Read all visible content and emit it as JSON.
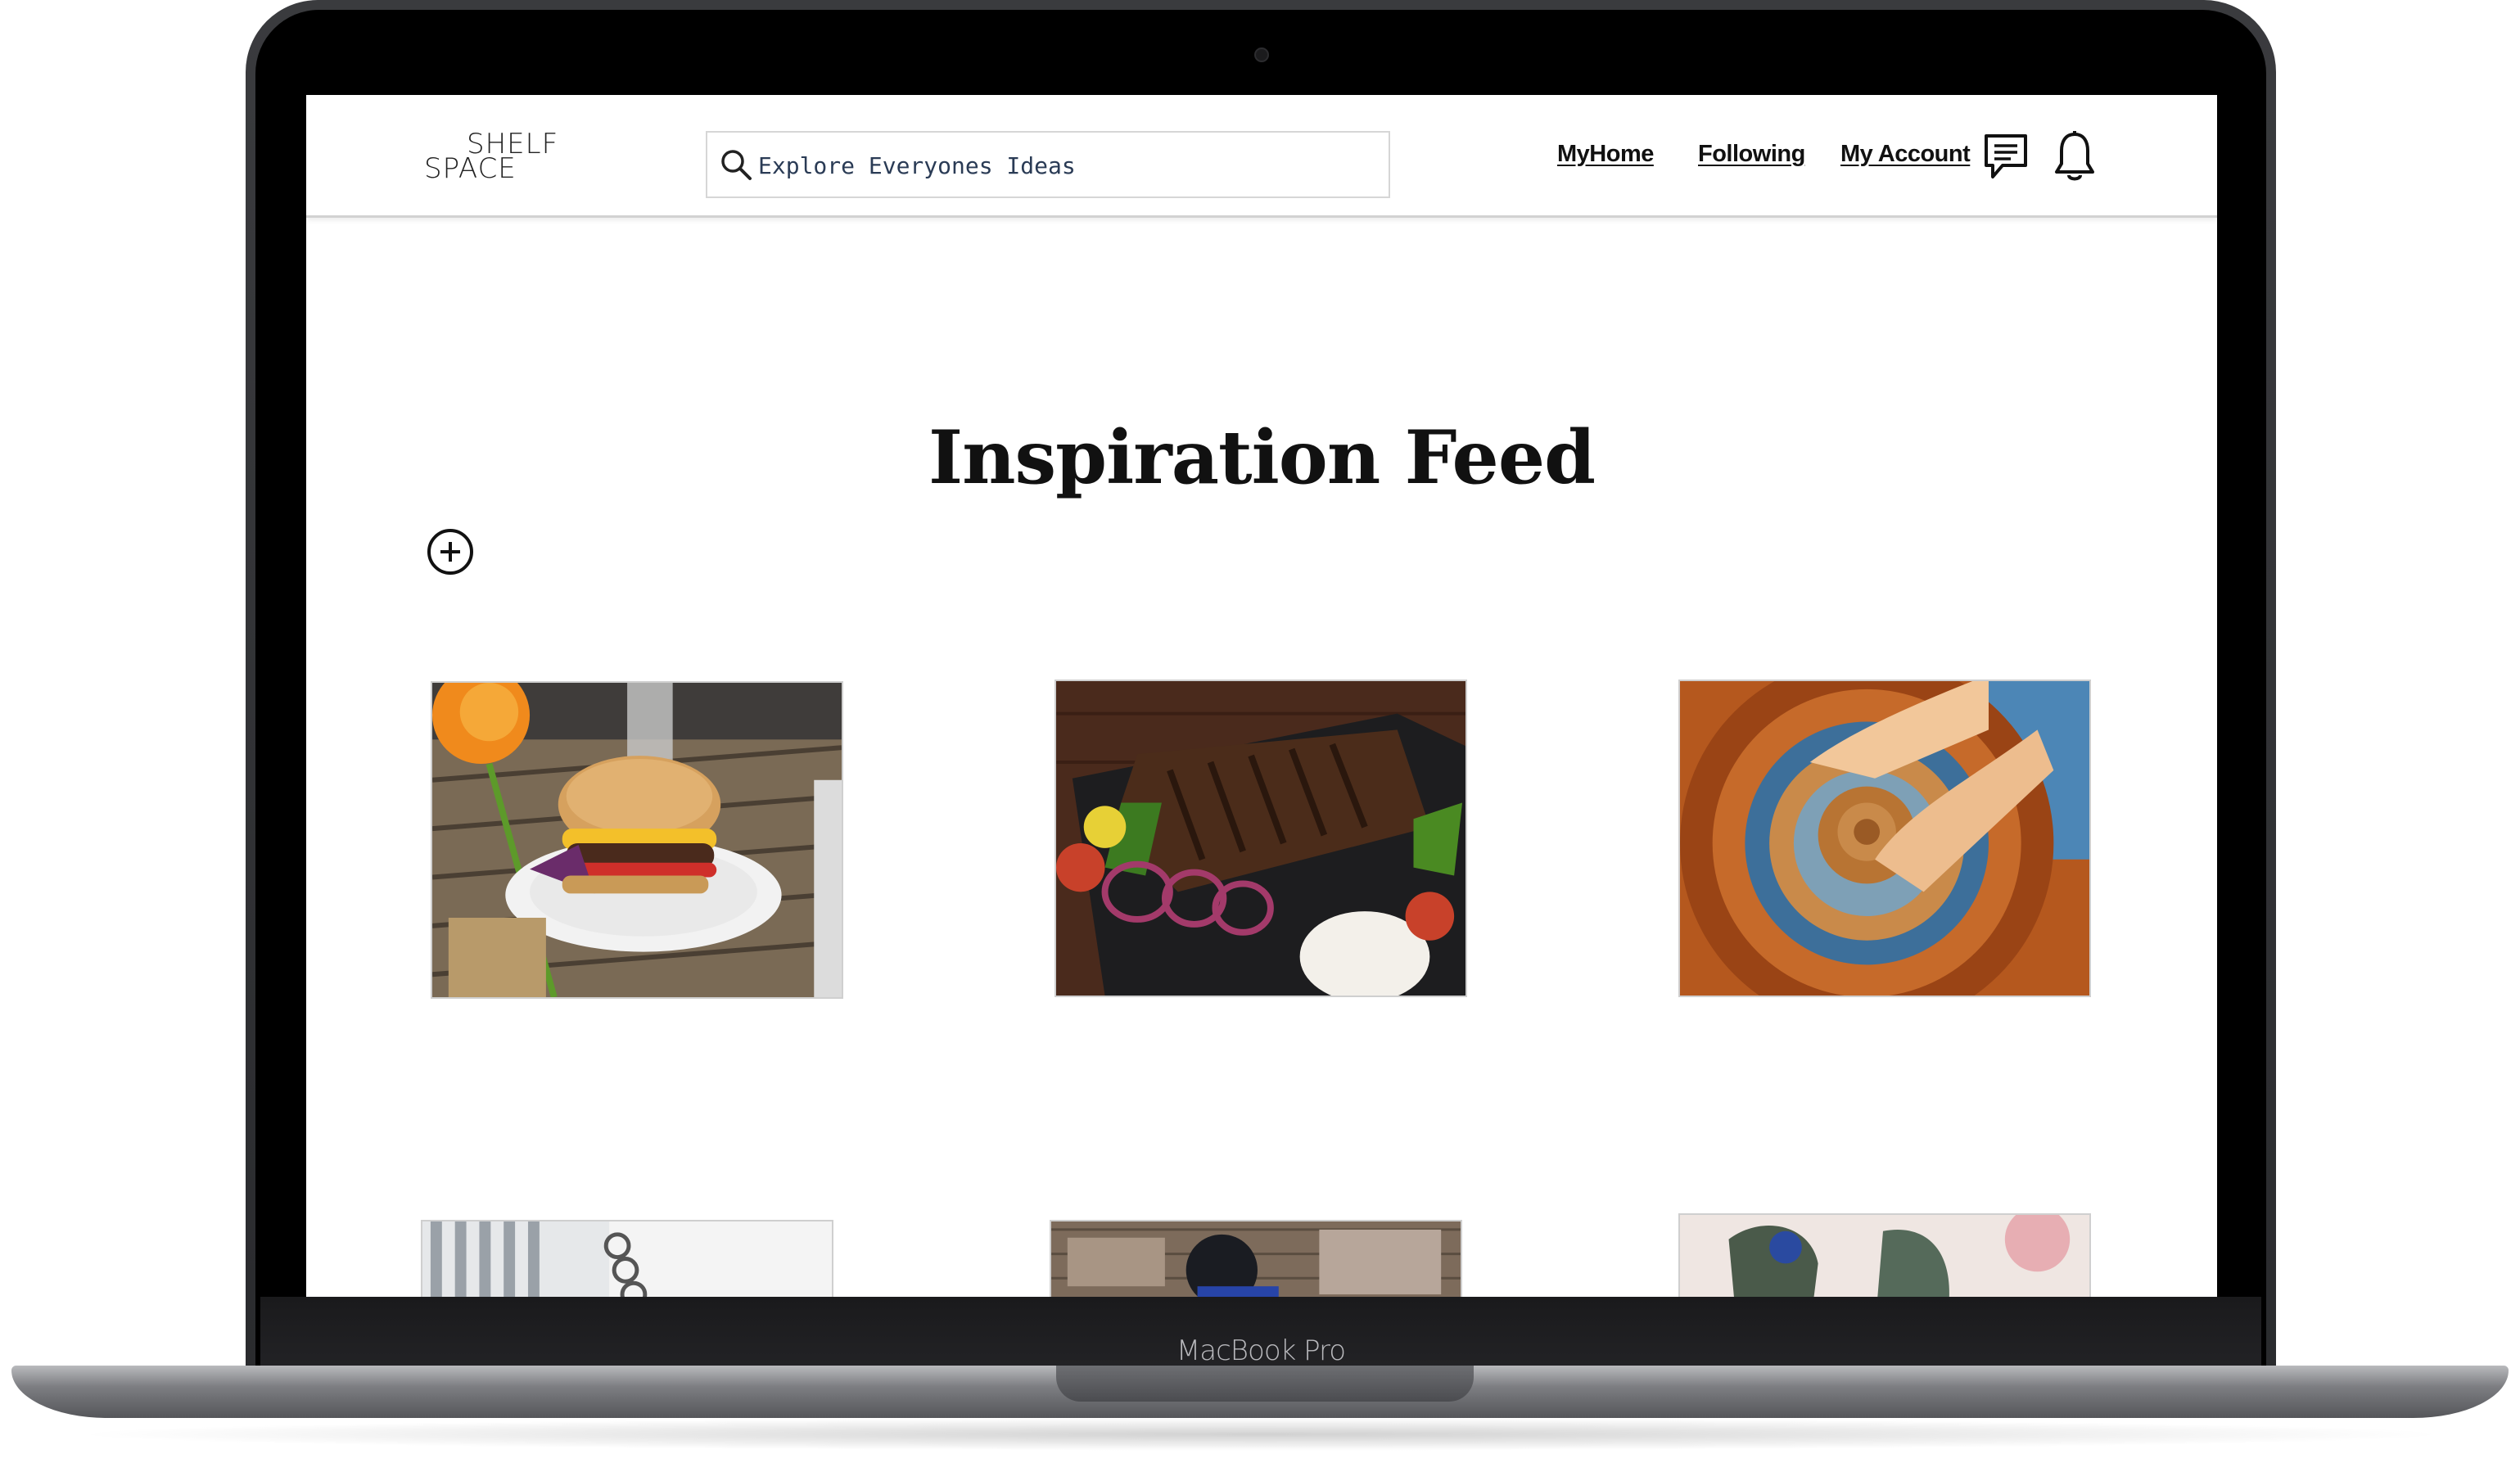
{
  "device": {
    "model_label": "MacBook Pro"
  },
  "header": {
    "logo": {
      "line1": "SHELF",
      "line2": "SPACE"
    },
    "search": {
      "placeholder": "Explore Everyones Ideas"
    },
    "nav": {
      "myhome": "MyHome",
      "following": "Following",
      "account": "My Account"
    },
    "icons": {
      "messages": "chat-icon",
      "notifications": "bell-icon"
    }
  },
  "main": {
    "title": "Inspiration Feed",
    "add_icon": "plus-circle-icon",
    "feed": [
      {
        "subject": "burger on plate"
      },
      {
        "subject": "grilled steak with onions and rice"
      },
      {
        "subject": "pottery wheel with clay"
      },
      {
        "subject": "notebook and binder"
      },
      {
        "subject": "baseball player in helmet"
      },
      {
        "subject": "hands with paint"
      }
    ]
  },
  "colors": {
    "search_text": "#2a3b55",
    "title_text": "#111111",
    "header_border": "#d2d2d2"
  }
}
